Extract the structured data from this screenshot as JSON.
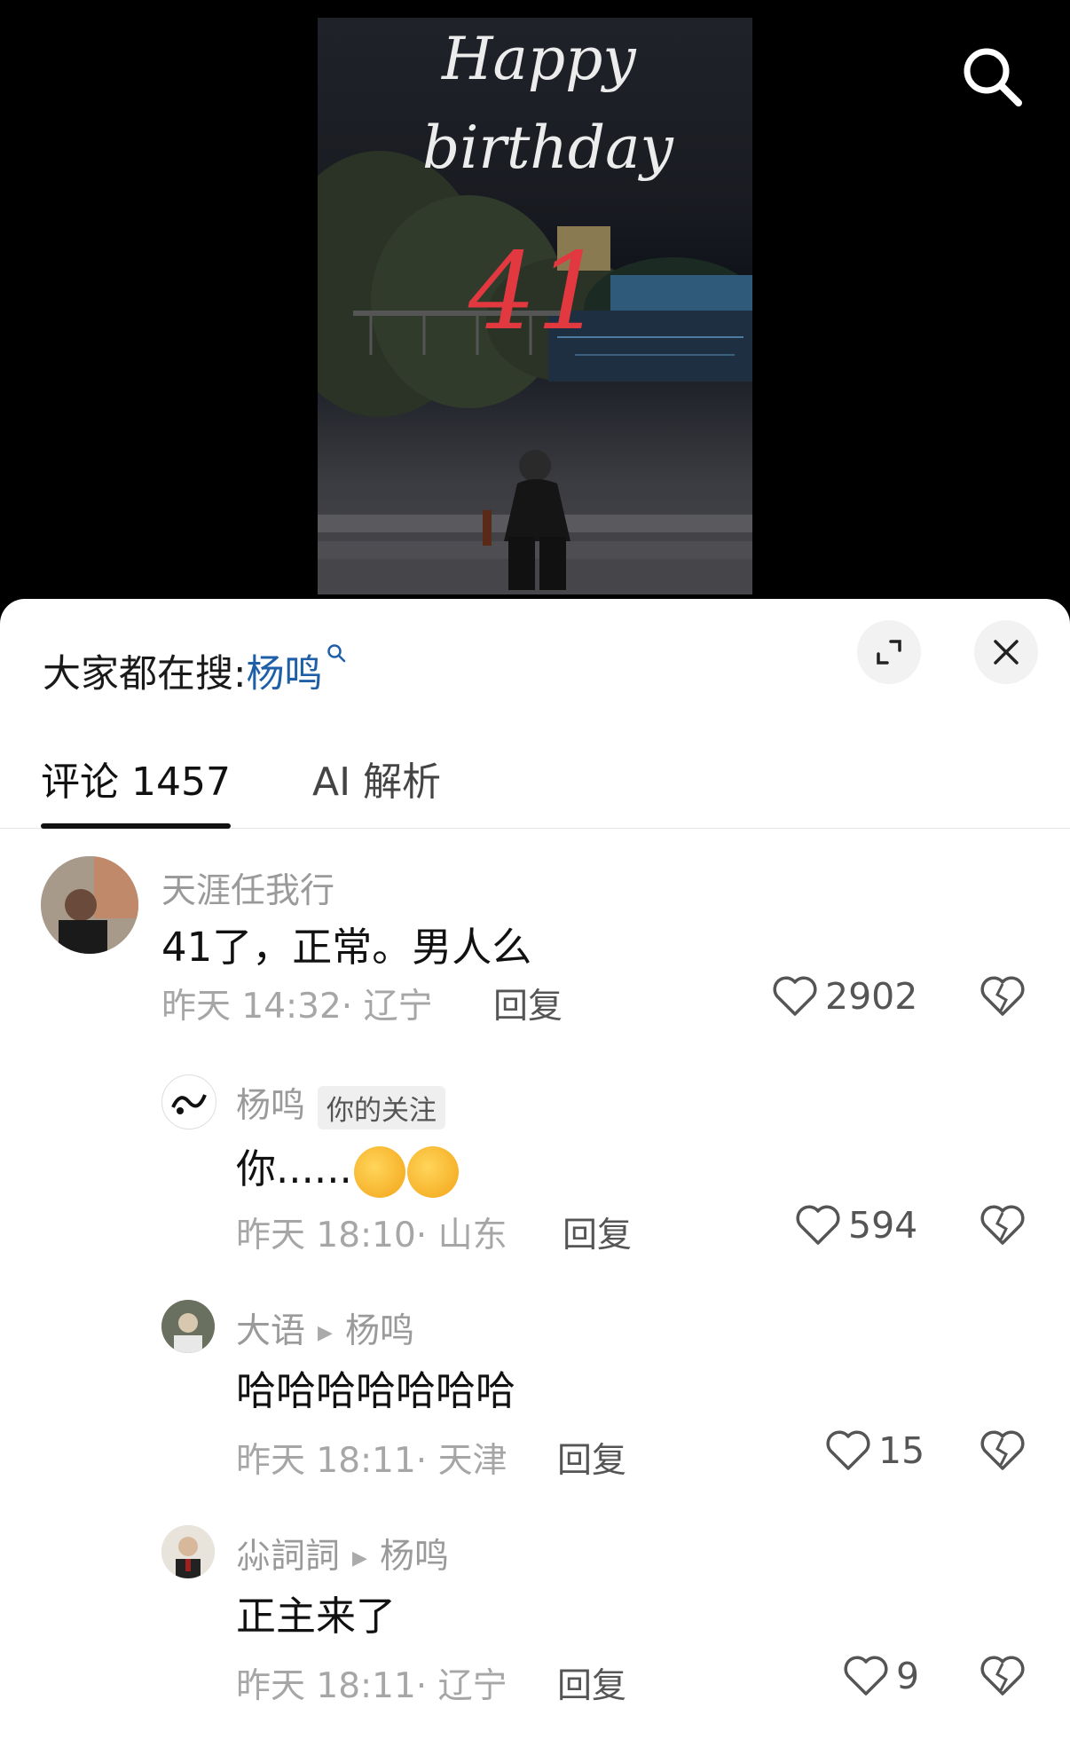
{
  "video": {
    "title_line1": "Happy",
    "title_line2": "birthday",
    "age": "41"
  },
  "hot_search": {
    "prefix": "大家都在搜:",
    "keyword": "杨鸣"
  },
  "tabs": [
    {
      "label": "评论 1457",
      "active": true
    },
    {
      "label": "AI 解析",
      "active": false
    }
  ],
  "comments": [
    {
      "username": "天涯任我行",
      "text": "41了，正常。男人么",
      "time": "昨天 14:32",
      "location": "辽宁",
      "reply_label": "回复",
      "likes": "2902"
    },
    {
      "username": "杨鸣",
      "badge": "你的关注",
      "text": "你......",
      "time": "昨天 18:10",
      "location": "山东",
      "reply_label": "回复",
      "likes": "594"
    },
    {
      "username": "大语",
      "reply_to": "杨鸣",
      "text": "哈哈哈哈哈哈哈",
      "time": "昨天 18:11",
      "location": "天津",
      "reply_label": "回复",
      "likes": "15"
    },
    {
      "username": "尛詞詞",
      "reply_to": "杨鸣",
      "text": "正主来了",
      "time": "昨天 18:11",
      "location": "辽宁",
      "reply_label": "回复",
      "likes": "9"
    }
  ],
  "icons": {
    "search": "search-icon",
    "expand": "expand-icon",
    "close": "close-icon",
    "like": "heart-icon",
    "dislike": "broken-heart-icon"
  }
}
